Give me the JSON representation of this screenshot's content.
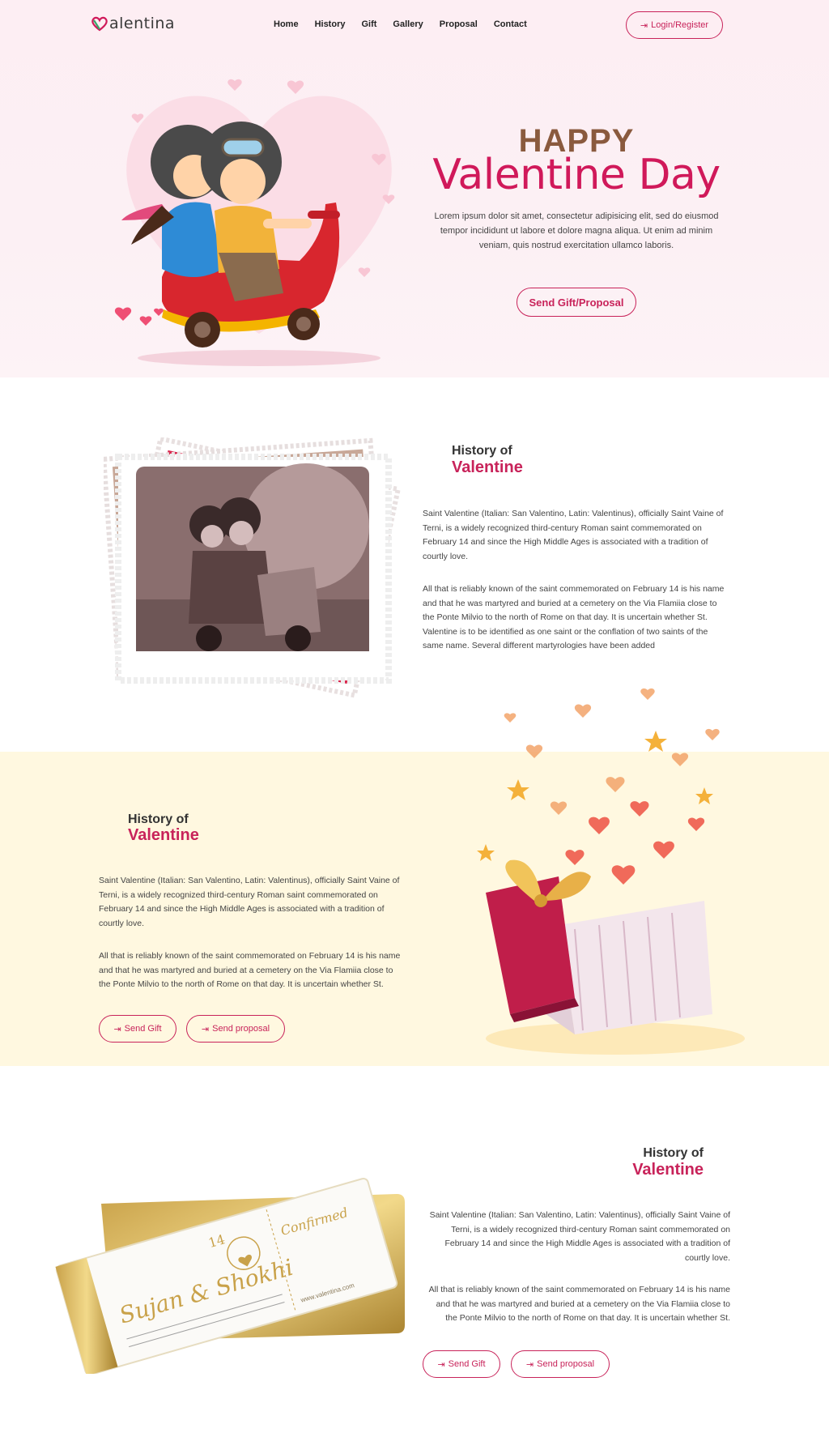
{
  "brand": {
    "name": "alentina",
    "logo_letter": "V"
  },
  "nav": {
    "items": [
      "Home",
      "History",
      "Gift",
      "Gallery",
      "Proposal",
      "Contact"
    ],
    "login_label": "Login/Register"
  },
  "hero": {
    "kicker": "HAPPY",
    "title": "Valentine Day",
    "description": "Lorem ipsum dolor sit amet, consectetur adipisicing elit, sed do eiusmod tempor incididunt ut labore et dolore magna aliqua. Ut enim ad minim veniam, quis nostrud exercitation ullamco laboris.",
    "cta_label": "Send Gift/Proposal"
  },
  "section1": {
    "heading_small": "History of",
    "heading_big": "Valentine",
    "paragraph1": "Saint Valentine (Italian: San Valentino, Latin: Valentinus), officially Saint Vaine of Terni, is a widely recognized third-century Roman saint commemorated on February 14 and since the High Middle Ages is associated with a tradition of courtly love.",
    "paragraph2": "All that is reliably known of the saint commemorated on February 14 is his name and that he was martyred and buried at a cemetery on the Via Flamiia close to the Ponte Milvio to the north of Rome on that day. It is uncertain whether St. Valentine is to be identified as one saint or the conflation of two saints of the same name. Several different martyrologies have been added"
  },
  "section2": {
    "heading_small": "History of",
    "heading_big": "Valentine",
    "paragraph1": "Saint Valentine (Italian: San Valentino, Latin: Valentinus), officially Saint Vaine of Terni, is a widely recognized third-century Roman saint commemorated on February 14 and since the High Middle Ages is associated with a tradition of courtly love.",
    "paragraph2": "All that is reliably known of the saint commemorated on February 14 is his name and that he was martyred and buried at a cemetery on the Via Flamiia close to the Ponte Milvio to the north of Rome on that day. It is uncertain whether St.",
    "btn_gift": "Send Gift",
    "btn_proposal": "Send proposal",
    "bg_color": "#fff8e0"
  },
  "section3": {
    "heading_small": "History of",
    "heading_big": "Valentine",
    "paragraph1": "Saint Valentine (Italian: San Valentino, Latin: Valentinus), officially Saint Vaine of Terni, is a widely recognized third-century Roman saint commemorated on February 14 and since the High Middle Ages is associated with a tradition of courtly love.",
    "paragraph2": "All that is reliably known of the saint commemorated on February 14 is his name and that he was martyred and buried at a cemetery on the Via Flamiia close to the Ponte Milvio to the north of Rome on that day. It is uncertain whether St.",
    "btn_gift": "Send Gift",
    "btn_proposal": "Send proposal",
    "ticket": {
      "names": "Sujan & Shokhi",
      "stamp": "Confirmed",
      "date_num": "14",
      "website": "www.valentina.com"
    }
  },
  "colors": {
    "accent": "#c8235a",
    "hero_bg": "#fdeef3",
    "title_brown": "#8a5a3e"
  }
}
